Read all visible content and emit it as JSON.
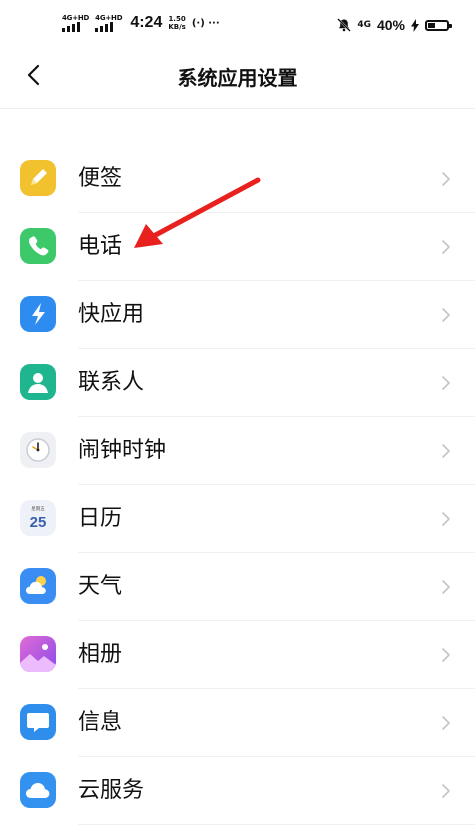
{
  "status_bar": {
    "sim1_label": "4G+HD",
    "sim2_label": "4G+HD",
    "time": "4:24",
    "speed_value": "1.50",
    "speed_unit": "KB/s",
    "misc": "(·) ···",
    "net_type": "4G",
    "battery_percent": "40%",
    "battery_level": 0.4
  },
  "header": {
    "title": "系统应用设置"
  },
  "apps": [
    {
      "label": "便签",
      "icon": "notes-icon",
      "color": "#F2C12E"
    },
    {
      "label": "电话",
      "icon": "phone-icon",
      "color": "#3DC96A"
    },
    {
      "label": "快应用",
      "icon": "quick-app-icon",
      "color": "#2E8CF0"
    },
    {
      "label": "联系人",
      "icon": "contacts-icon",
      "color": "#1FB58F"
    },
    {
      "label": "闹钟时钟",
      "icon": "clock-icon",
      "color": "#EEF0F4"
    },
    {
      "label": "日历",
      "icon": "calendar-icon",
      "color": "#EEF1F7",
      "badge": "25",
      "badge_top": "星期五"
    },
    {
      "label": "天气",
      "icon": "weather-icon",
      "color": "#3A8DF2"
    },
    {
      "label": "相册",
      "icon": "gallery-icon",
      "color": "#B156E6"
    },
    {
      "label": "信息",
      "icon": "messages-icon",
      "color": "#2F8DEB"
    },
    {
      "label": "云服务",
      "icon": "cloud-service-icon",
      "color": "#3391F0"
    }
  ],
  "annotation": {
    "color": "#E8211E",
    "target": "电话"
  }
}
